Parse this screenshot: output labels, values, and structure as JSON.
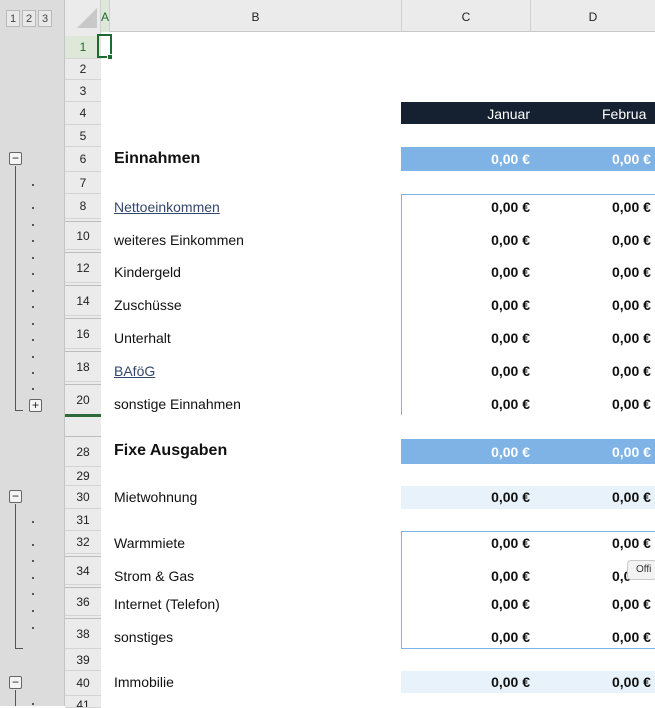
{
  "outline": {
    "levels": [
      "1",
      "2",
      "3"
    ],
    "collapse_glyph": "−",
    "expand_glyph": "+"
  },
  "columns": [
    "A",
    "B",
    "C",
    "D"
  ],
  "header_row": {
    "c": "Januar",
    "d": "Februa"
  },
  "rows": {
    "r6": {
      "num": "6",
      "label": "Einnahmen",
      "c": "0,00 €",
      "d": "0,00 €"
    },
    "r8": {
      "num": "8",
      "label": "Nettoeinkommen",
      "c": "0,00 €",
      "d": "0,00 €"
    },
    "r10": {
      "num": "10",
      "label": "weiteres Einkommen",
      "c": "0,00 €",
      "d": "0,00 €"
    },
    "r12": {
      "num": "12",
      "label": "Kindergeld",
      "c": "0,00 €",
      "d": "0,00 €"
    },
    "r14": {
      "num": "14",
      "label": "Zuschüsse",
      "c": "0,00 €",
      "d": "0,00 €"
    },
    "r16": {
      "num": "16",
      "label": "Unterhalt",
      "c": "0,00 €",
      "d": "0,00 €"
    },
    "r18": {
      "num": "18",
      "label": "BAföG",
      "c": "0,00 €",
      "d": "0,00 €"
    },
    "r20": {
      "num": "20",
      "label": "sonstige Einnahmen",
      "c": "0,00 €",
      "d": "0,00 €"
    },
    "r28": {
      "num": "28",
      "label": "Fixe Ausgaben",
      "c": "0,00 €",
      "d": "0,00 €"
    },
    "r30": {
      "num": "30",
      "label": "Mietwohnung",
      "c": "0,00 €",
      "d": "0,00 €"
    },
    "r32": {
      "num": "32",
      "label": "Warmmiete",
      "c": "0,00 €",
      "d": "0,00 €"
    },
    "r34": {
      "num": "34",
      "label": "Strom & Gas",
      "c": "0,00 €",
      "d": "0,0"
    },
    "r36": {
      "num": "36",
      "label": "Internet (Telefon)",
      "c": "0,00 €",
      "d": "0,00 €"
    },
    "r38": {
      "num": "38",
      "label": "sonstiges",
      "c": "0,00 €",
      "d": "0,00 €"
    },
    "r40": {
      "num": "40",
      "label": "Immobilie",
      "c": "0,00 €",
      "d": "0,00 €"
    }
  },
  "plain_rows": [
    "1",
    "2",
    "3",
    "4",
    "5",
    "7",
    "29",
    "31",
    "39",
    "41"
  ],
  "tooltip": "Offi",
  "colors": {
    "header_dark": "#152030",
    "section_blue": "#7fb3e6",
    "light_band": "#e8f2fb",
    "selection": "#1d6b2e"
  }
}
